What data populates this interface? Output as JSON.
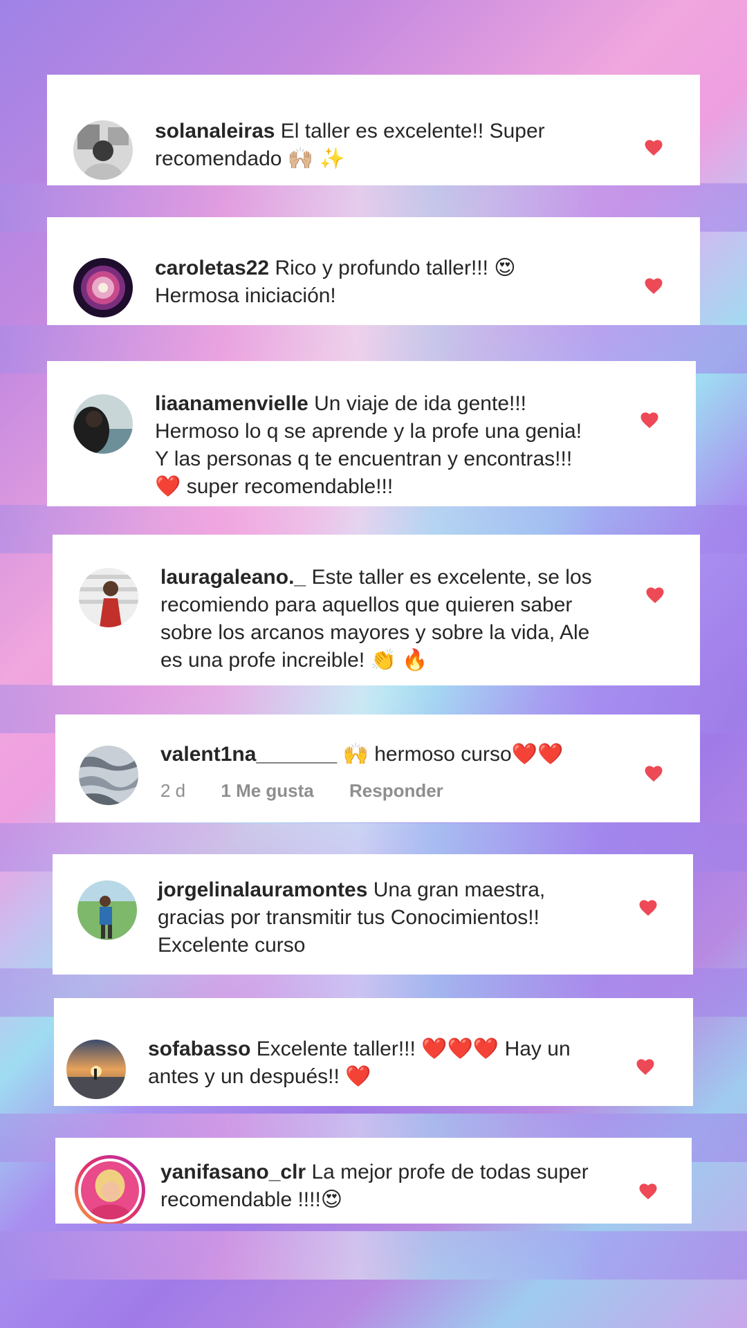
{
  "comments": [
    {
      "username": "solanaleiras",
      "text": "El taller es excelente!! Super recomendado 🙌🏼 ✨"
    },
    {
      "username": "caroletas22",
      "text": "Rico y profundo taller!!! 😍 Hermosa iniciación!"
    },
    {
      "username": "liaanamenvielle",
      "text": "Un viaje de ida gente!!! Hermoso lo q se aprende y la profe una genia! Y las personas q te encuentran y encontras!!!❤️ super recomendable!!!"
    },
    {
      "username": "lauragaleano._",
      "text": "Este taller es excelente, se los recomiendo para aquellos que quieren saber sobre los arcanos mayores y sobre la vida, Ale es una profe increible! 👏 🔥"
    },
    {
      "username": "valent1na_______",
      "text": "🙌 hermoso curso❤️❤️",
      "time": "2 d",
      "likes": "1 Me gusta",
      "reply": "Responder"
    },
    {
      "username": "jorgelinalauramontes",
      "text": "Una gran maestra, gracias por transmitir tus Conocimientos!! Excelente curso"
    },
    {
      "username": "sofabasso",
      "text": "Excelente taller!!! ❤️❤️❤️ Hay un antes y un después!! ❤️"
    },
    {
      "username": "yanifasano_clr",
      "text": "La mejor profe de todas super recomendable !!!!😍"
    }
  ],
  "colors": {
    "heart": "#ed4956",
    "text": "#262626",
    "meta": "#8e8e8e"
  },
  "icons": {
    "like": "heart-icon",
    "avatar": "avatar"
  }
}
